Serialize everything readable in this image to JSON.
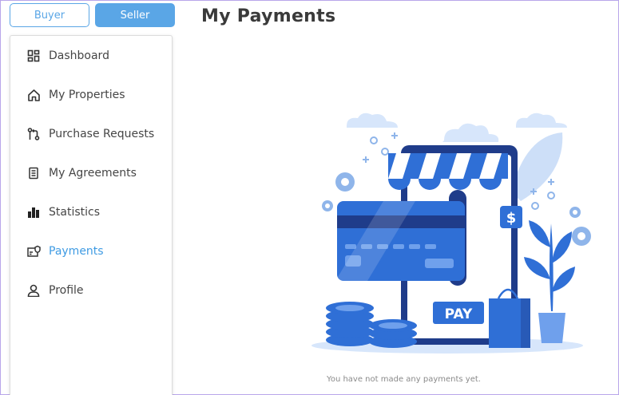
{
  "role_toggle": {
    "buyer_label": "Buyer",
    "seller_label": "Seller"
  },
  "sidebar": {
    "items": [
      {
        "label": "Dashboard",
        "icon": "dashboard-icon"
      },
      {
        "label": "My Properties",
        "icon": "home-icon"
      },
      {
        "label": "Purchase Requests",
        "icon": "pull-request-icon"
      },
      {
        "label": "My Agreements",
        "icon": "document-icon"
      },
      {
        "label": "Statistics",
        "icon": "bar-chart-icon"
      },
      {
        "label": "Payments",
        "icon": "payment-card-icon",
        "active": true
      },
      {
        "label": "Profile",
        "icon": "user-icon"
      }
    ]
  },
  "main": {
    "title": "My Payments",
    "empty_message": "You have not made any payments yet.",
    "illustration": {
      "pay_label": "PAY",
      "dollar_sign": "$"
    }
  },
  "colors": {
    "accent": "#5aa6e6",
    "active_text": "#3f9be3",
    "illustration_blue": "#2f6fd6"
  }
}
